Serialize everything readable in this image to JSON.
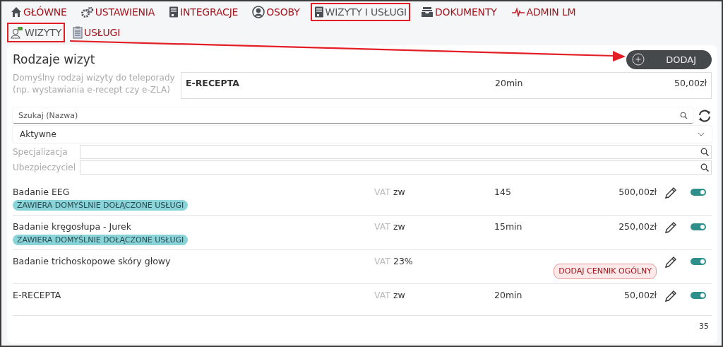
{
  "nav": [
    {
      "label": "GŁÓWNE",
      "selected": false,
      "highlighted": false
    },
    {
      "label": "USTAWIENIA",
      "selected": false,
      "highlighted": false
    },
    {
      "label": "INTEGRACJE",
      "selected": false,
      "highlighted": false
    },
    {
      "label": "OSOBY",
      "selected": false,
      "highlighted": false
    },
    {
      "label": "WIZYTY I USŁUGI",
      "selected": true,
      "highlighted": true
    },
    {
      "label": "DOKUMENTY",
      "selected": false,
      "highlighted": false
    },
    {
      "label": "ADMIN LM",
      "selected": false,
      "highlighted": false
    }
  ],
  "subnav": [
    {
      "label": "WIZYTY",
      "selected": true,
      "highlighted": true
    },
    {
      "label": "USŁUGI",
      "selected": false,
      "highlighted": false
    }
  ],
  "panel": {
    "title": "Rodzaje wizyt",
    "add_button": "DODAJ",
    "teleporada": {
      "label": "Domyślny rodzaj wizyty do teleporady (np. wystawiania e-recept czy e-ZLA)",
      "name": "E-RECEPTA",
      "duration": "20min",
      "price": "50,00zł"
    },
    "search": {
      "placeholder": "Szukaj (Nazwa)"
    },
    "status_select": {
      "value": "Aktywne"
    },
    "filters": [
      {
        "label": "Specjalizacja"
      },
      {
        "label": "Ubezpieczyciel"
      }
    ],
    "rows": [
      {
        "name": "Badanie EEG",
        "vat_label": "VAT",
        "vat": "zw",
        "duration": "145",
        "price": "500,00zł",
        "badge": {
          "kind": "info",
          "text": "ZAWIERA DOMYŚLNIE DOŁĄCZONE USŁUGI"
        },
        "on": true
      },
      {
        "name": "Badanie kręgosłupa - Jurek",
        "vat_label": "VAT",
        "vat": "zw",
        "duration": "15min",
        "price": "250,00zł",
        "badge": {
          "kind": "info",
          "text": "ZAWIERA DOMYŚLNIE DOŁĄCZONE USŁUGI"
        },
        "on": true
      },
      {
        "name": "Badanie trichoskopowe skóry głowy",
        "vat_label": "VAT",
        "vat": "23%",
        "badge": {
          "kind": "warning",
          "text": "DODAJ CENNIK OGÓLNY"
        },
        "on": true
      },
      {
        "name": "E-RECEPTA",
        "vat_label": "VAT",
        "vat": "zw",
        "duration": "20min",
        "price": "50,00zł",
        "on": true
      }
    ],
    "count": "35"
  }
}
